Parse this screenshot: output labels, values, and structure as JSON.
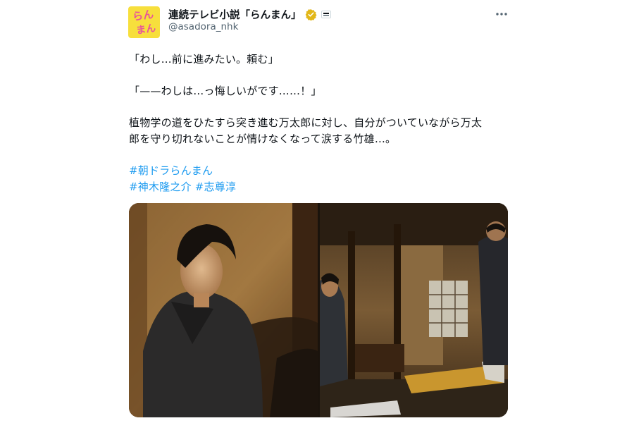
{
  "account": {
    "display_name": "連続テレビ小説「らんまん」",
    "handle": "@asadora_nhk",
    "avatar_text_line1": "らん",
    "avatar_text_line2": "まん",
    "verified_color": "#e2b719"
  },
  "tweet": {
    "lines": [
      "「わし…前に進みたい。頼む」",
      "「——わしは…っ悔しいがです……！」",
      "植物学の道をひたすら突き進む万太郎に対し、自分がついていながら万太",
      "郎を守り切れないことが情けなくなって涙する竹雄…。"
    ],
    "hashtags": {
      "tag1": "#朝ドラらんまん",
      "tag2": "#神木隆之介",
      "tag3": "#志尊淳"
    }
  },
  "colors": {
    "text": "#0f1419",
    "secondary": "#536471",
    "link": "#1d9bf0",
    "avatar_bg": "#f7df3c"
  },
  "icons": {
    "more": "more-dots-icon",
    "verified": "verified-badge-icon",
    "affiliate": "affiliate-badge-icon"
  }
}
